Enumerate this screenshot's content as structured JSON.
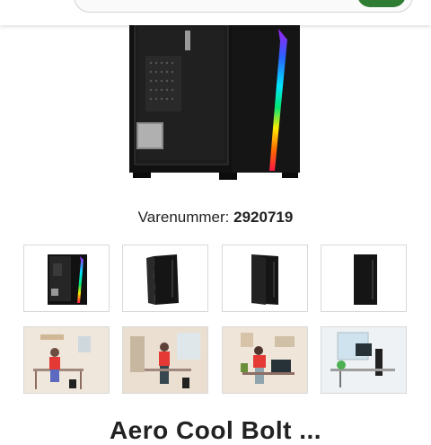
{
  "header": {
    "search_placeholder": ""
  },
  "product": {
    "sku_label": "Varenummer:",
    "sku_value": "2920719",
    "title": "Aero Cool Bolt ..."
  },
  "thumbnails": [
    {
      "label": "aerocool-case-rgb"
    },
    {
      "label": "tower-pc-black"
    },
    {
      "label": "tower-pc-black-2"
    },
    {
      "label": "tower-pc-black-3"
    },
    {
      "label": "woman-at-desk-1"
    },
    {
      "label": "woman-at-desk-2"
    },
    {
      "label": "woman-at-desk-3"
    },
    {
      "label": "office-desk-workstation"
    }
  ],
  "colors": {
    "accent_green": "#2e7d32",
    "border": "#d9d9d9"
  }
}
